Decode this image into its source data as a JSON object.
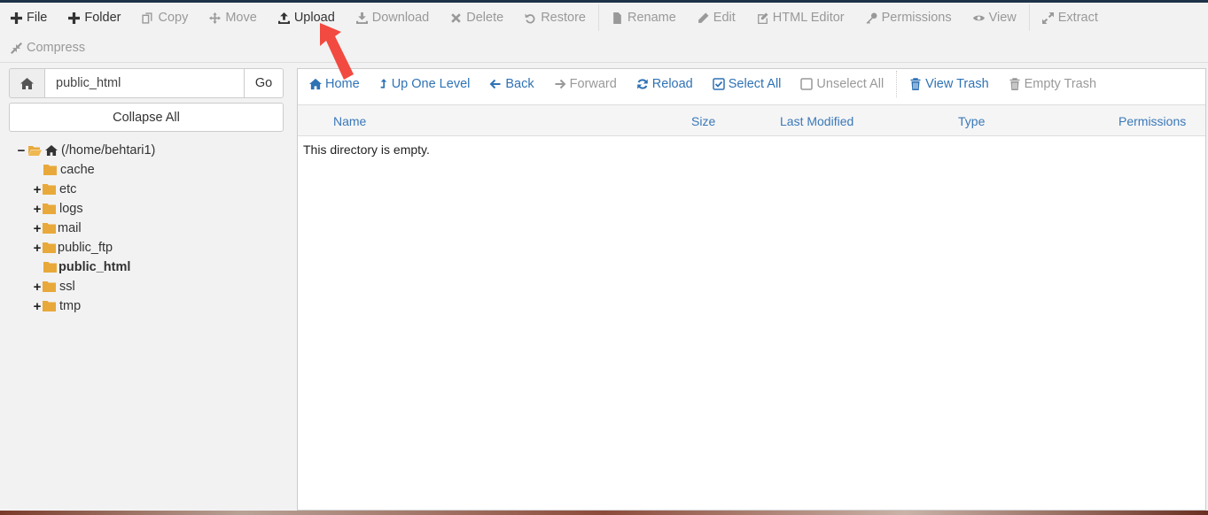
{
  "toolbar": {
    "row1": [
      {
        "label": "File",
        "icon": "plus-icon",
        "active": true
      },
      {
        "label": "Folder",
        "icon": "plus-icon",
        "active": true
      },
      {
        "label": "Copy",
        "icon": "copy-icon",
        "active": false
      },
      {
        "label": "Move",
        "icon": "move-icon",
        "active": false
      },
      {
        "label": "Upload",
        "icon": "upload-icon",
        "active": true
      },
      {
        "label": "Download",
        "icon": "download-icon",
        "active": false
      },
      {
        "label": "Delete",
        "icon": "close-icon",
        "active": false
      },
      {
        "label": "Restore",
        "icon": "undo-icon",
        "active": false
      },
      {
        "label": "Rename",
        "icon": "file-icon",
        "active": false
      },
      {
        "label": "Edit",
        "icon": "pencil-icon",
        "active": false
      },
      {
        "label": "HTML Editor",
        "icon": "edit-square-icon",
        "active": false
      },
      {
        "label": "Permissions",
        "icon": "key-icon",
        "active": false
      },
      {
        "label": "View",
        "icon": "eye-icon",
        "active": false
      },
      {
        "label": "Extract",
        "icon": "expand-icon",
        "active": false
      }
    ],
    "row2": [
      {
        "label": "Compress",
        "icon": "compress-icon",
        "active": false
      }
    ]
  },
  "left_panel": {
    "path_value": "public_html",
    "go_label": "Go",
    "collapse_label": "Collapse All",
    "tree": {
      "root_label": "(/home/behtari1)",
      "items": [
        {
          "label": "cache",
          "expandable": false,
          "current": false
        },
        {
          "label": "etc",
          "expandable": true,
          "current": false
        },
        {
          "label": "logs",
          "expandable": true,
          "current": false
        },
        {
          "label": "mail",
          "expandable": true,
          "current": false
        },
        {
          "label": "public_ftp",
          "expandable": true,
          "current": false
        },
        {
          "label": "public_html",
          "expandable": false,
          "current": true
        },
        {
          "label": "ssl",
          "expandable": true,
          "current": false
        },
        {
          "label": "tmp",
          "expandable": true,
          "current": false
        }
      ]
    }
  },
  "nav_bar": {
    "home": "Home",
    "up": "Up One Level",
    "back": "Back",
    "forward": "Forward",
    "reload": "Reload",
    "select_all": "Select All",
    "unselect_all": "Unselect All",
    "view_trash": "View Trash",
    "empty_trash": "Empty Trash"
  },
  "table": {
    "columns": [
      "Name",
      "Size",
      "Last Modified",
      "Type",
      "Permissions"
    ],
    "empty_message": "This directory is empty."
  },
  "colors": {
    "link_blue": "#2f72b5",
    "disabled_gray": "#999999",
    "folder_orange": "#e8a93a",
    "annotation_red": "#f24a40"
  }
}
